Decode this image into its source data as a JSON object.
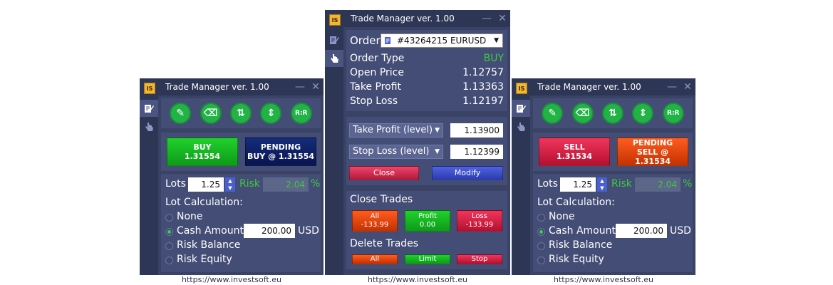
{
  "title": "Trade Manager ver. 1.00",
  "logo_text": "IS",
  "footer_url": "https://www.investsoft.eu",
  "colors": {
    "window_bg": "#3a4366",
    "panel_bg": "#434d75",
    "accent_green": "#22b347",
    "risk_green": "#3fc93f"
  },
  "tools": {
    "rr_label": "R:R",
    "icons": [
      "pencil-icon",
      "eraser-icon",
      "trend-arrows-icon",
      "level-icon"
    ]
  },
  "left": {
    "buy_label": "BUY",
    "buy_price": "1.31554",
    "pending_label": "PENDING",
    "pending_sub": "BUY @ 1.31554",
    "lots_label": "Lots",
    "lots_value": "1.25",
    "risk_label": "Risk",
    "risk_value": "2.04",
    "risk_unit": "%",
    "lot_calc_label": "Lot Calculation:",
    "options": [
      "None",
      "Cash Amount",
      "Risk Balance",
      "Risk Equity"
    ],
    "selected_option": "Cash Amount",
    "cash_value": "200.00",
    "cash_unit": "USD"
  },
  "middle": {
    "order_label": "Order",
    "order_value": "#43264215  EURUSD",
    "order_type_label": "Order Type",
    "order_type_value": "BUY",
    "open_price_label": "Open Price",
    "open_price_value": "1.12757",
    "take_profit_label": "Take Profit",
    "take_profit_value": "1.13363",
    "stop_loss_label": "Stop Loss",
    "stop_loss_value": "1.12197",
    "tp_select": "Take Profit (level)",
    "tp_input": "1.13900",
    "sl_select": "Stop Loss (level)",
    "sl_input": "1.12399",
    "close_label": "Close",
    "modify_label": "Modify",
    "close_trades_label": "Close Trades",
    "all_label": "All",
    "all_value": "-133.99",
    "profit_label": "Profit",
    "profit_value": "0.00",
    "loss_label": "Loss",
    "loss_value": "-133.99",
    "delete_trades_label": "Delete Trades",
    "del_all": "All",
    "del_limit": "Limit",
    "del_stop": "Stop"
  },
  "right": {
    "sell_label": "SELL",
    "sell_price": "1.31534",
    "pending_label": "PENDING",
    "pending_sub": "SELL @ 1.31534",
    "lots_label": "Lots",
    "lots_value": "1.25",
    "risk_label": "Risk",
    "risk_value": "2.04",
    "risk_unit": "%",
    "lot_calc_label": "Lot Calculation:",
    "options": [
      "None",
      "Cash Amount",
      "Risk Balance",
      "Risk Equity"
    ],
    "selected_option": "Cash Amount",
    "cash_value": "200.00",
    "cash_unit": "USD"
  }
}
